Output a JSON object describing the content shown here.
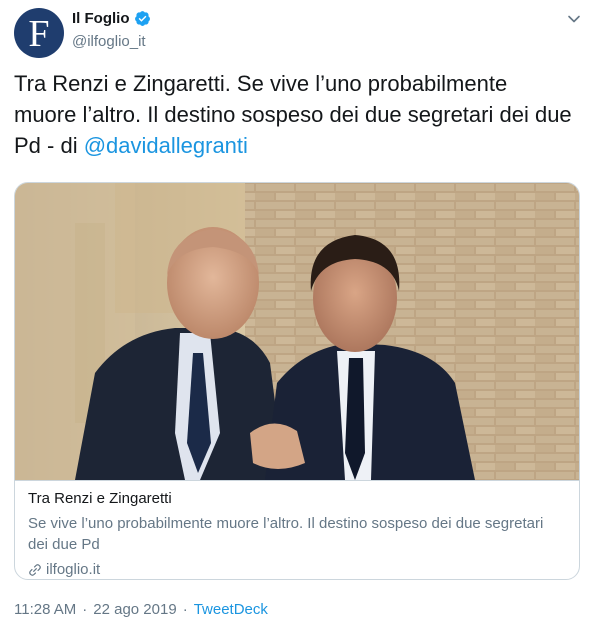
{
  "author": {
    "name": "Il Foglio",
    "handle": "@ilfoglio_it",
    "avatar_letter": "F",
    "verified_icon": "verified-badge-icon"
  },
  "tweet": {
    "text": "Tra Renzi e Zingaretti. Se vive l’uno probabilmente muore l’altro. Il destino sospeso dei due segretari dei due Pd - di ",
    "mention": "@davidallegranti"
  },
  "card": {
    "title": "Tra Renzi e Zingaretti",
    "description": "Se vive l’uno probabilmente muore l’altro. Il destino sospeso dei due segretari dei due Pd",
    "domain": "ilfoglio.it"
  },
  "meta": {
    "time": "11:28 AM",
    "separator": "·",
    "date": "22 ago 2019",
    "source": "TweetDeck"
  },
  "colors": {
    "accent": "#1b95e0",
    "secondary_text": "#657786",
    "avatar_bg": "#1f3d6e"
  }
}
